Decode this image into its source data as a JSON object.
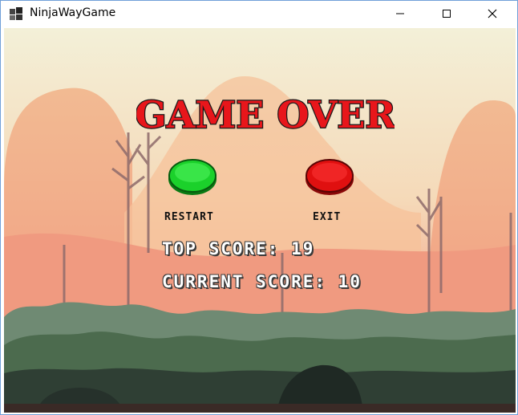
{
  "window": {
    "title": "NinjaWayGame"
  },
  "game_over": {
    "heading": "GAME OVER"
  },
  "buttons": {
    "restart": {
      "label": "RESTART",
      "color": "#1bd12b"
    },
    "exit": {
      "label": "EXIT",
      "color": "#e01010"
    }
  },
  "scores": {
    "top_label": "TOP SCORE:",
    "top_value": "19",
    "current_label": "CURRENT SCORE:",
    "current_value": "10"
  },
  "colors": {
    "title_red": "#e8161b",
    "sky_top": "#f3f0d8",
    "sky_bottom": "#f2917a"
  }
}
